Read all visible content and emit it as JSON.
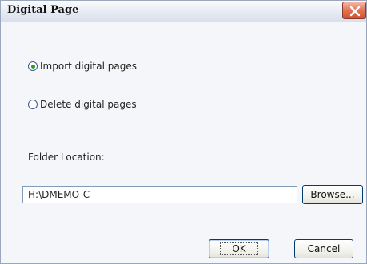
{
  "window": {
    "title": "Digital Page"
  },
  "options": {
    "import_label": "Import digital pages",
    "delete_label": "Delete digital pages",
    "selected": "import"
  },
  "folder": {
    "label": "Folder Location:",
    "value": "H:\\DMEMO-C",
    "browse_label": "Browse..."
  },
  "buttons": {
    "ok_label": "OK",
    "cancel_label": "Cancel"
  },
  "colors": {
    "close_button": "#e27452",
    "radio_selected": "#2b9a2b",
    "button_border": "#003c74"
  }
}
